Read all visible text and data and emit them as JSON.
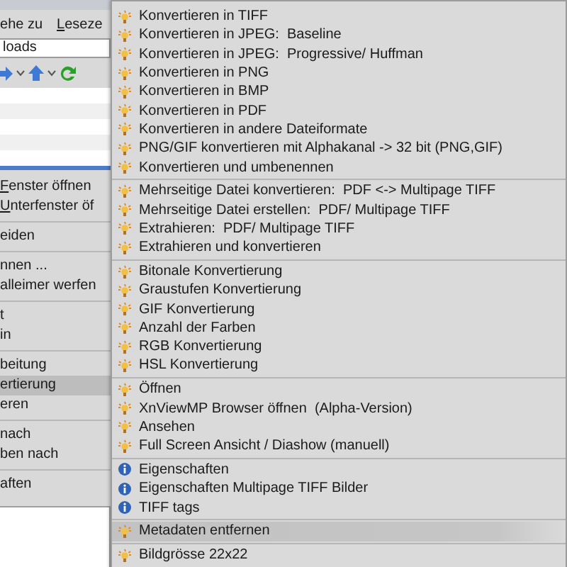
{
  "background_window": {
    "menubar": [
      {
        "label": "ehe zu",
        "mnemonic": false
      },
      {
        "label": "Leseze",
        "mnemonic": true
      }
    ],
    "address": "loads",
    "context_menu": [
      {
        "kind": "item",
        "label": "Fenster öffnen",
        "mnemonic": true,
        "selected": false
      },
      {
        "kind": "item",
        "label": "Unterfenster öf",
        "mnemonic": true,
        "selected": false
      },
      {
        "kind": "separator"
      },
      {
        "kind": "item",
        "label": "eiden",
        "mnemonic": false,
        "selected": false
      },
      {
        "kind": "separator"
      },
      {
        "kind": "item",
        "label": "nnen ...",
        "mnemonic": false,
        "selected": false
      },
      {
        "kind": "item",
        "label": "alleimer werfen",
        "mnemonic": false,
        "selected": false
      },
      {
        "kind": "separator"
      },
      {
        "kind": "item",
        "label": "t",
        "mnemonic": false,
        "selected": false
      },
      {
        "kind": "item",
        "label": "in",
        "mnemonic": false,
        "selected": false
      },
      {
        "kind": "separator"
      },
      {
        "kind": "item",
        "label": "beitung",
        "mnemonic": false,
        "selected": false
      },
      {
        "kind": "item",
        "label": "ertierung",
        "mnemonic": false,
        "selected": true
      },
      {
        "kind": "item",
        "label": "eren",
        "mnemonic": false,
        "selected": false
      },
      {
        "kind": "separator"
      },
      {
        "kind": "item",
        "label": "nach",
        "mnemonic": false,
        "selected": false
      },
      {
        "kind": "item",
        "label": "ben nach",
        "mnemonic": false,
        "selected": false
      },
      {
        "kind": "separator"
      },
      {
        "kind": "item",
        "label": "aften",
        "mnemonic": false,
        "selected": false
      }
    ]
  },
  "submenu": [
    {
      "kind": "tool",
      "label": "Konvertieren in TIFF",
      "selected": false
    },
    {
      "kind": "tool",
      "label": "Konvertieren in JPEG:  Baseline",
      "selected": false
    },
    {
      "kind": "tool",
      "label": "Konvertieren in JPEG:  Progressive/ Huffman",
      "selected": false
    },
    {
      "kind": "tool",
      "label": "Konvertieren in PNG",
      "selected": false
    },
    {
      "kind": "tool",
      "label": "Konvertieren in BMP",
      "selected": false
    },
    {
      "kind": "tool",
      "label": "Konvertieren in PDF",
      "selected": false
    },
    {
      "kind": "tool",
      "label": "Konvertieren in andere Dateiformate",
      "selected": false
    },
    {
      "kind": "tool",
      "label": "PNG/GIF konvertieren mit Alphakanal -> 32 bit (PNG,GIF)",
      "selected": false
    },
    {
      "kind": "tool",
      "label": "Konvertieren und umbenennen",
      "selected": false
    },
    {
      "kind": "separator"
    },
    {
      "kind": "tool",
      "label": "Mehrseitige Datei konvertieren:  PDF <-> Multipage TIFF",
      "selected": false
    },
    {
      "kind": "tool",
      "label": "Mehrseitige Datei erstellen:  PDF/ Multipage TIFF",
      "selected": false
    },
    {
      "kind": "tool",
      "label": "Extrahieren:  PDF/ Multipage TIFF",
      "selected": false
    },
    {
      "kind": "tool",
      "label": "Extrahieren und konvertieren",
      "selected": false
    },
    {
      "kind": "separator"
    },
    {
      "kind": "tool",
      "label": "Bitonale Konvertierung",
      "selected": false
    },
    {
      "kind": "tool",
      "label": "Graustufen Konvertierung",
      "selected": false
    },
    {
      "kind": "tool",
      "label": "GIF Konvertierung",
      "selected": false
    },
    {
      "kind": "tool",
      "label": "Anzahl der Farben",
      "selected": false
    },
    {
      "kind": "tool",
      "label": "RGB Konvertierung",
      "selected": false
    },
    {
      "kind": "tool",
      "label": "HSL Konvertierung",
      "selected": false
    },
    {
      "kind": "separator"
    },
    {
      "kind": "tool",
      "label": "Öffnen",
      "selected": false
    },
    {
      "kind": "tool",
      "label": "XnViewMP Browser öffnen  (Alpha-Version)",
      "selected": false
    },
    {
      "kind": "tool",
      "label": "Ansehen",
      "selected": false
    },
    {
      "kind": "tool",
      "label": "Full Screen Ansicht / Diashow (manuell)",
      "selected": false
    },
    {
      "kind": "separator"
    },
    {
      "kind": "info",
      "label": "Eigenschaften",
      "selected": false
    },
    {
      "kind": "info",
      "label": "Eigenschaften Multipage TIFF Bilder",
      "selected": false
    },
    {
      "kind": "info",
      "label": "TIFF tags",
      "selected": false
    },
    {
      "kind": "separator"
    },
    {
      "kind": "tool",
      "label": "Metadaten entfernen",
      "selected": true
    },
    {
      "kind": "separator"
    },
    {
      "kind": "tool",
      "label": "Bildgrösse 22x22",
      "selected": false
    }
  ]
}
